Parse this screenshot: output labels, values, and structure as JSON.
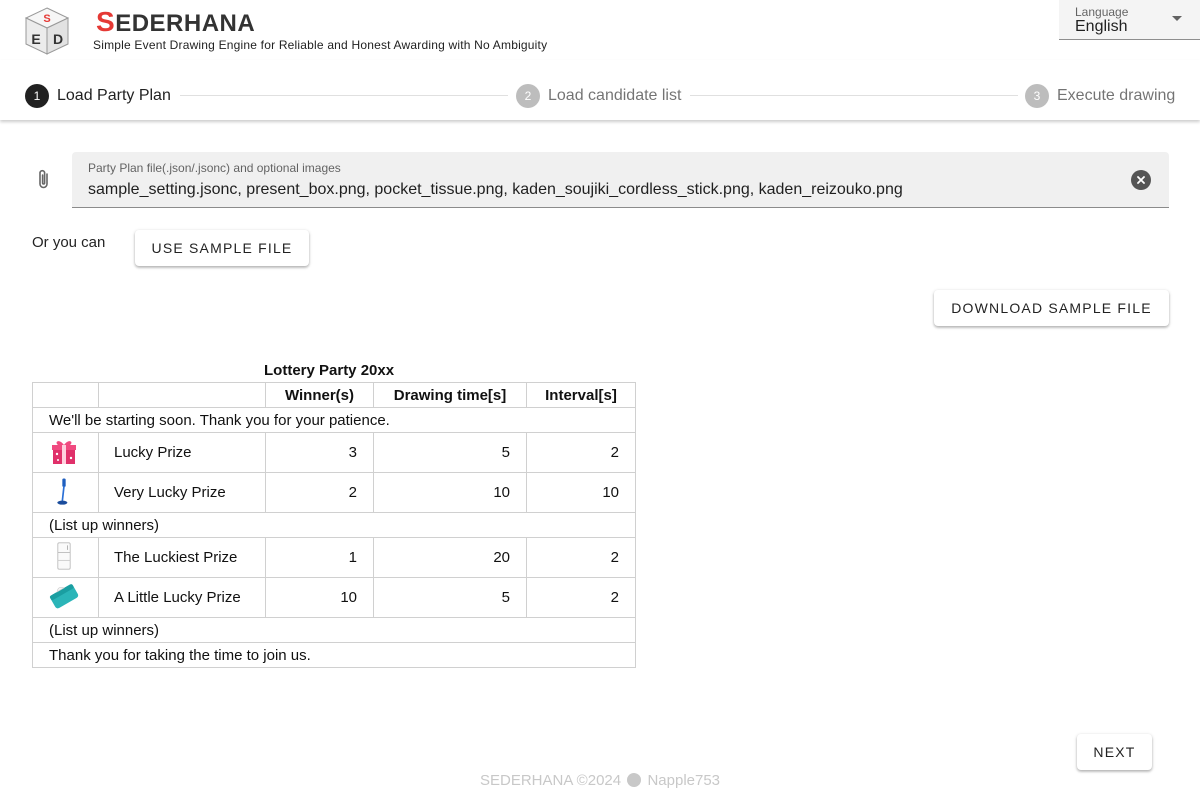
{
  "header": {
    "brand_first": "S",
    "brand_rest": "EDERHANA",
    "tagline": "Simple Event Drawing Engine for Reliable and Honest Awarding with No Ambiguity",
    "logo_letters": [
      "S",
      "E",
      "D"
    ],
    "language": {
      "label": "Language",
      "value": "English"
    }
  },
  "stepper": [
    {
      "number": "1",
      "label": "Load Party Plan",
      "state": "active"
    },
    {
      "number": "2",
      "label": "Load candidate list",
      "state": "inactive"
    },
    {
      "number": "3",
      "label": "Execute drawing",
      "state": "inactive"
    }
  ],
  "file_input": {
    "label": "Party Plan file(.json/.jsonc) and optional images",
    "value": "sample_setting.jsonc, present_box.png, pocket_tissue.png, kaden_soujiki_cordless_stick.png, kaden_reizouko.png"
  },
  "or_text": "Or you can",
  "buttons": {
    "use_sample": "USE SAMPLE FILE",
    "download_sample": "DOWNLOAD SAMPLE FILE",
    "next": "NEXT"
  },
  "plan": {
    "title": "Lottery Party 20xx",
    "headers": [
      "Winner(s)",
      "Drawing time[s]",
      "Interval[s]"
    ],
    "message_start": "We'll be starting soon. Thank you for your patience.",
    "prizes_1": [
      {
        "icon": "present-box-icon",
        "name": "Lucky Prize",
        "winners": "3",
        "drawing_time": "5",
        "interval": "2"
      },
      {
        "icon": "cordless-vacuum-icon",
        "name": "Very Lucky Prize",
        "winners": "2",
        "drawing_time": "10",
        "interval": "10"
      }
    ],
    "list_winners_1": "(List up winners)",
    "prizes_2": [
      {
        "icon": "refrigerator-icon",
        "name": "The Luckiest Prize",
        "winners": "1",
        "drawing_time": "20",
        "interval": "2"
      },
      {
        "icon": "pocket-tissue-icon",
        "name": "A Little Lucky Prize",
        "winners": "10",
        "drawing_time": "5",
        "interval": "2"
      }
    ],
    "list_winners_2": "(List up winners)",
    "message_end": "Thank you for taking the time to join us."
  },
  "footer": {
    "left": "SEDERHANA ©2024",
    "right": "Napple753"
  },
  "colors": {
    "brand_red": "#e53935",
    "active_step": "#212121",
    "inactive_step": "#bdbdbd"
  }
}
